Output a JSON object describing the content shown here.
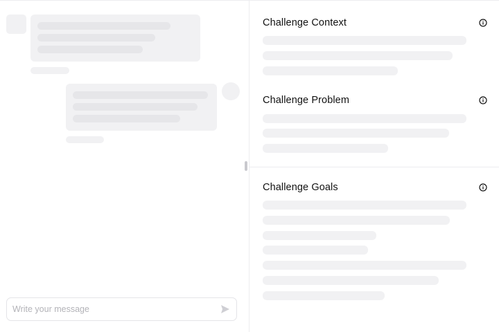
{
  "composer": {
    "placeholder": "Write your message",
    "send_icon": "send-icon"
  },
  "sections": [
    {
      "title": "Challenge Context",
      "info_icon": "info-icon"
    },
    {
      "title": "Challenge Problem",
      "info_icon": "info-icon"
    },
    {
      "title": "Challenge Goals",
      "info_icon": "info-icon"
    }
  ],
  "colors": {
    "skeleton_bg": "#f1f1f3",
    "skeleton_line": "#e6e6e9",
    "border": "#ececef",
    "text": "#111111",
    "placeholder": "#b3b3b8"
  }
}
